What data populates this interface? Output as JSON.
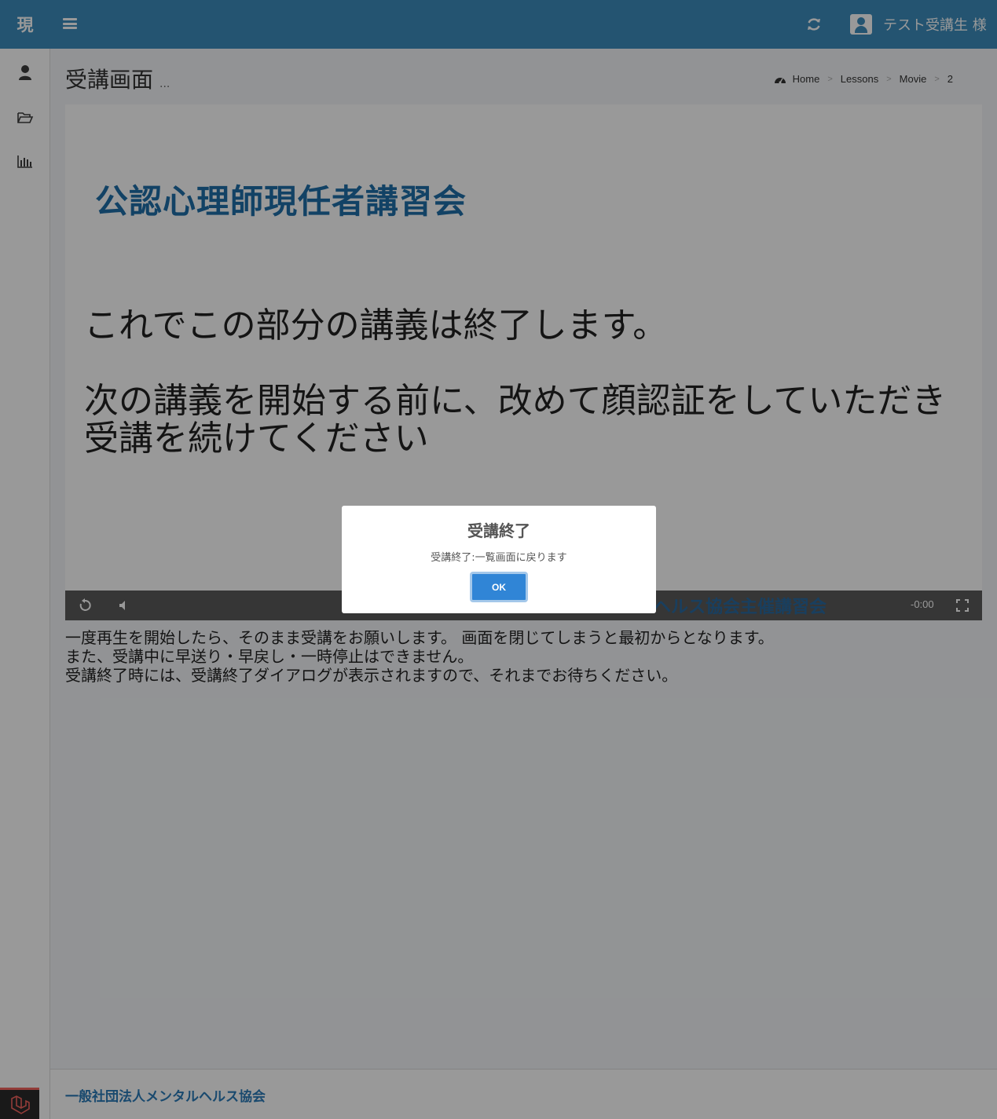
{
  "header": {
    "brand": "現",
    "user_name": "テスト受講生 様"
  },
  "sidebar": {
    "items": [
      {
        "icon": "user-icon"
      },
      {
        "icon": "folder-open-icon"
      },
      {
        "icon": "bar-chart-icon"
      }
    ]
  },
  "page": {
    "title": "受講画面",
    "title_suffix": "...",
    "breadcrumb": [
      "Home",
      "Lessons",
      "Movie",
      "2"
    ]
  },
  "video": {
    "slide_title": "公認心理師現任者講習会",
    "line1": "これでこの部分の講義は終了します。",
    "line2": "次の講義を開始する前に、改めて顔認証をしていただき",
    "line3": "受講を続けてください",
    "subtitle": "ルヘルス協会主催講習会",
    "time": "-0:00"
  },
  "notes": [
    "一度再生を開始したら、そのまま受講をお願いします。 画面を閉じてしまうと最初からとなります。",
    "また、受講中に早送り・早戻し・一時停止はできません。",
    "受講終了時には、受講終了ダイアログが表示されますので、それまでお待ちください。"
  ],
  "footer": {
    "text": "一般社団法人メンタルヘルス協会"
  },
  "dialog": {
    "title": "受講終了",
    "message": "受講終了:一覧画面に戻ります",
    "ok_label": "OK"
  },
  "colors": {
    "header_bg": "#3c8dbc",
    "ok_button": "#3085d6",
    "slide_title": "#1f6fa8"
  }
}
